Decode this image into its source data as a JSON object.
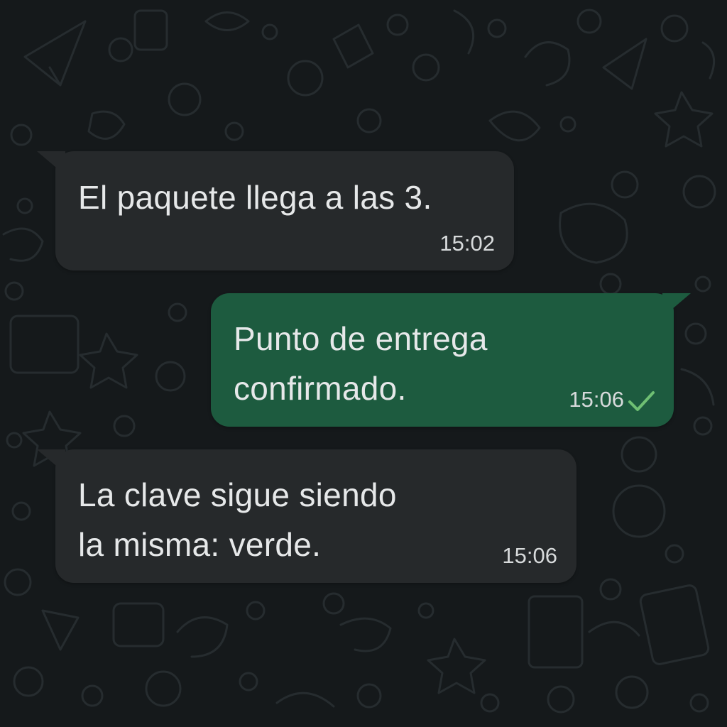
{
  "conversation": {
    "messages": [
      {
        "direction": "incoming",
        "text": "El paquete llega a las 3.",
        "time": "15:02"
      },
      {
        "direction": "outgoing",
        "text": "Punto de entrega\nconfirmado.",
        "time": "15:06",
        "status_icon": "single-check-icon"
      },
      {
        "direction": "incoming",
        "text": "La clave sigue siendo\nla misma: verde.",
        "time": "15:06"
      }
    ]
  },
  "theme": {
    "background": "#15191b",
    "incoming_bubble": "#26292b",
    "outgoing_bubble": "#1d5b3f",
    "check_color": "#6fbf73"
  }
}
